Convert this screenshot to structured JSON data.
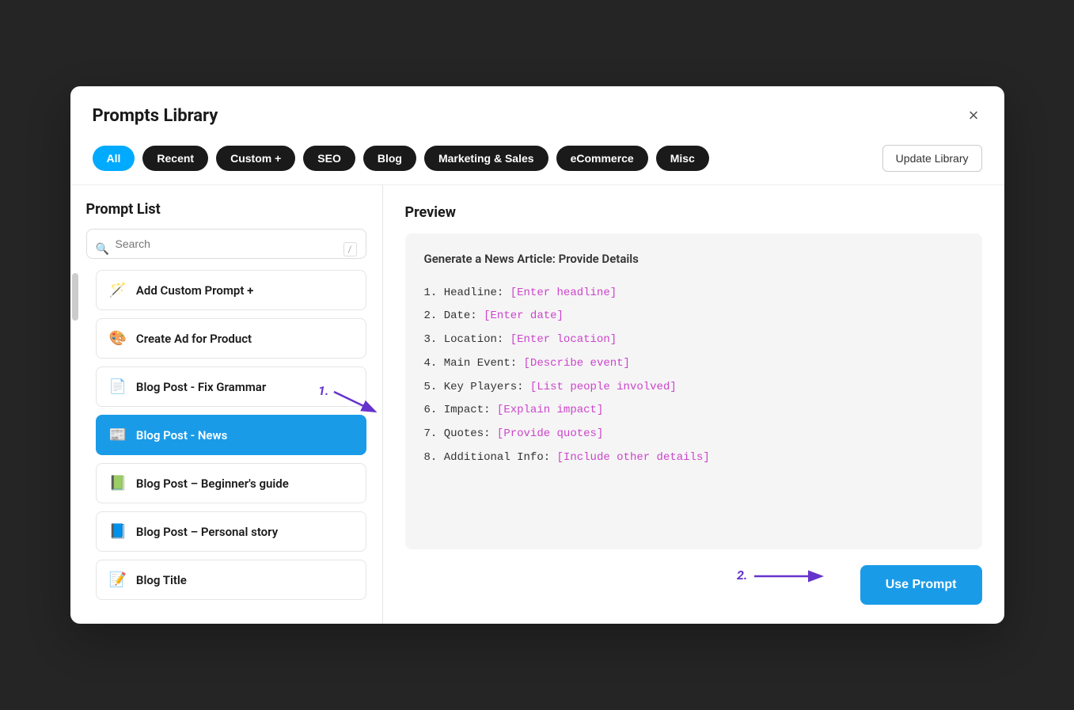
{
  "modal": {
    "title": "Prompts Library",
    "close_label": "×"
  },
  "filters": {
    "buttons": [
      {
        "label": "All",
        "active": true
      },
      {
        "label": "Recent",
        "active": false
      },
      {
        "label": "Custom +",
        "active": false
      },
      {
        "label": "SEO",
        "active": false
      },
      {
        "label": "Blog",
        "active": false
      },
      {
        "label": "Marketing & Sales",
        "active": false
      },
      {
        "label": "eCommerce",
        "active": false
      },
      {
        "label": "Misc",
        "active": false
      }
    ],
    "update_library": "Update Library"
  },
  "prompt_list": {
    "title": "Prompt List",
    "search_placeholder": "Search",
    "search_shortcut": "/",
    "items": [
      {
        "icon": "🪄",
        "label": "Add Custom Prompt +",
        "selected": false,
        "id": "add-custom"
      },
      {
        "icon": "🎨",
        "label": "Create Ad for Product",
        "selected": false,
        "id": "create-ad"
      },
      {
        "icon": "📄",
        "label": "Blog Post - Fix Grammar",
        "selected": false,
        "id": "blog-fix-grammar"
      },
      {
        "icon": "📰",
        "label": "Blog Post - News",
        "selected": true,
        "id": "blog-news"
      },
      {
        "icon": "📗",
        "label": "Blog Post – Beginner's guide",
        "selected": false,
        "id": "blog-beginners"
      },
      {
        "icon": "📘",
        "label": "Blog Post – Personal story",
        "selected": false,
        "id": "blog-personal"
      },
      {
        "icon": "📝",
        "label": "Blog Title",
        "selected": false,
        "id": "blog-title"
      }
    ]
  },
  "preview": {
    "title": "Preview",
    "heading": "Generate a News Article: Provide Details",
    "items": [
      {
        "number": "1",
        "label": "Headline:",
        "placeholder": "[Enter headline]"
      },
      {
        "number": "2",
        "label": "Date:",
        "placeholder": "[Enter date]"
      },
      {
        "number": "3",
        "label": "Location:",
        "placeholder": "[Enter location]"
      },
      {
        "number": "4",
        "label": "Main Event:",
        "placeholder": "[Describe event]"
      },
      {
        "number": "5",
        "label": "Key Players:",
        "placeholder": "[List people involved]"
      },
      {
        "number": "6",
        "label": "Impact:",
        "placeholder": "[Explain impact]"
      },
      {
        "number": "7",
        "label": "Quotes:",
        "placeholder": "[Provide quotes]"
      },
      {
        "number": "8",
        "label": "Additional Info:",
        "placeholder": "[Include other details]"
      }
    ],
    "use_prompt_label": "Use Prompt"
  },
  "annotations": {
    "step1_label": "1.",
    "step2_label": "2."
  }
}
